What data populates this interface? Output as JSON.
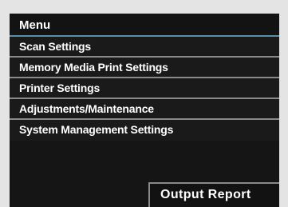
{
  "menu": {
    "title": "Menu",
    "items": [
      {
        "label": "Scan Settings"
      },
      {
        "label": "Memory Media Print Settings"
      },
      {
        "label": "Printer Settings"
      },
      {
        "label": "Adjustments/Maintenance"
      },
      {
        "label": "System Management Settings"
      }
    ]
  },
  "footer": {
    "output_report_label": "Output Report"
  },
  "colors": {
    "background": "#151515",
    "header_underline": "#5a8ea8",
    "divider": "#8a8a8a",
    "text": "#ffffff"
  }
}
